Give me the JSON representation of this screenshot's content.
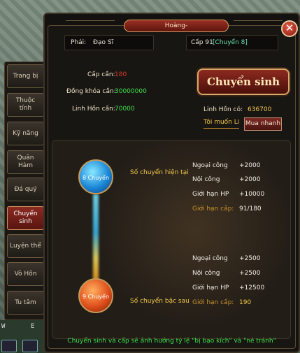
{
  "window": {
    "title": "Hoàng-",
    "close_glyph": "✕"
  },
  "sidebar": {
    "items": [
      {
        "label": "Trang bị"
      },
      {
        "label": "Thuộc tính"
      },
      {
        "label": "Kỹ năng"
      },
      {
        "label": "Quân Hàm"
      },
      {
        "label": "Đá quý"
      },
      {
        "label": "Chuyển sinh"
      },
      {
        "label": "Luyện thể"
      },
      {
        "label": "Võ Hồn"
      },
      {
        "label": "Tu tâm"
      }
    ],
    "active_index": 5
  },
  "hud": {
    "w_label": "W",
    "e_label": "E"
  },
  "info": {
    "faction_label": "Phái:",
    "faction_value": "Đạo Sĩ",
    "level_label": "Cấp 91",
    "level_tag": "[Chuyển 8]"
  },
  "requirements": {
    "level_req_label": "Cấp cần:",
    "level_req_value": "180",
    "bound_copper_label": "Đồng khóa cần:",
    "bound_copper_value": "30000000",
    "soul_req_label": "Linh Hồn cần:",
    "soul_req_value": "70000"
  },
  "owned": {
    "soul_owned_label": "Linh Hồn có:",
    "soul_owned_value": "636700"
  },
  "actions": {
    "rebirth_button": "Chuyển sinh",
    "want_link": "Tôi muốn Li",
    "buy_button": "Mua nhanh"
  },
  "current": {
    "orb_label": "8 Chuyển",
    "caption": "Số chuyển hiện tại",
    "stats": [
      {
        "label": "Ngoại công",
        "value": "+2000"
      },
      {
        "label": "Nội công",
        "value": "+2000"
      },
      {
        "label": "Giới hạn HP",
        "value": "+10000"
      },
      {
        "label": "Giới hạn cấp:",
        "value": "91/180"
      }
    ]
  },
  "next": {
    "orb_label": "9 Chuyển",
    "caption": "Số chuyển bậc sau",
    "stats": [
      {
        "label": "Ngoại công",
        "value": "+2500"
      },
      {
        "label": "Nội công",
        "value": "+2500"
      },
      {
        "label": "Giới hạn HP",
        "value": "+12500"
      },
      {
        "label": "Giới hạn cấp:",
        "value": "190"
      }
    ]
  },
  "footer": {
    "note": "Chuyển sinh và cấp sẽ ảnh hưởng tỷ lệ \"bị bạo kích\" và \"né tránh\""
  }
}
